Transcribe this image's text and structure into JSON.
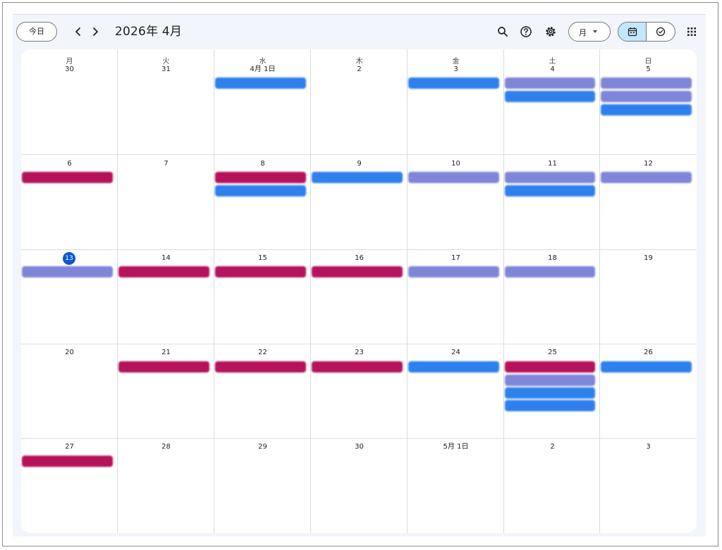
{
  "toolbar": {
    "today_label": "今日",
    "title": "2026年 4月",
    "view_label": "月"
  },
  "icons": {
    "prev": "chevron-left-icon",
    "next": "chevron-right-icon",
    "search": "search-icon",
    "help": "help-icon",
    "settings": "gear-icon",
    "calendar_view": "calendar-icon",
    "tasks_view": "check-circle-icon",
    "apps": "apps-grid-icon"
  },
  "colors": {
    "blue_event": "#2f80ed",
    "red_event": "#b5135a",
    "lavender_event": "#7f86d8",
    "today_highlight": "#0b57d0",
    "selected_toggle": "#c2e7ff"
  },
  "weekdays": [
    "月",
    "火",
    "水",
    "木",
    "金",
    "土",
    "日"
  ],
  "weeks": [
    [
      "30",
      "31",
      "4月 1日",
      "2",
      "3",
      "4",
      "5"
    ],
    [
      "6",
      "7",
      "8",
      "9",
      "10",
      "11",
      "12"
    ],
    [
      "13",
      "14",
      "15",
      "16",
      "17",
      "18",
      "19"
    ],
    [
      "20",
      "21",
      "22",
      "23",
      "24",
      "25",
      "26"
    ],
    [
      "27",
      "28",
      "29",
      "30",
      "5月 1日",
      "2",
      "3"
    ]
  ],
  "today": "13"
}
